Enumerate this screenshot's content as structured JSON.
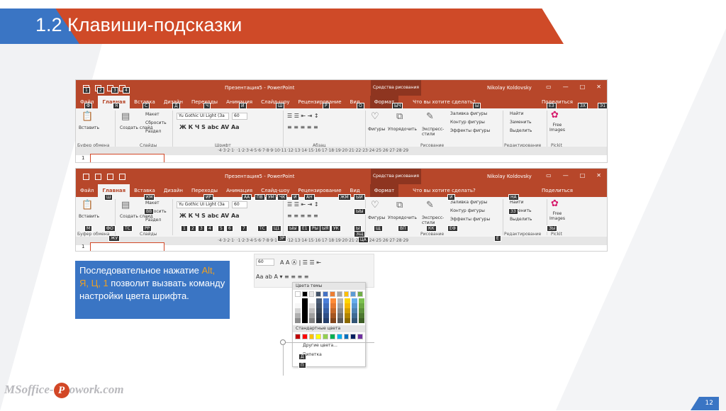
{
  "slide": {
    "title": "1.2 Клавиши-подсказки",
    "page_number": "12",
    "logo_text_1": "MSoffice-",
    "logo_p": "P",
    "logo_text_2": "owork.com"
  },
  "colors": {
    "accent_red": "#cf4a28",
    "accent_blue": "#3a75c4",
    "ppt_ribbon": "#b7472a"
  },
  "app": {
    "title": "Презентация5 - PowerPoint",
    "context": "Средства рисования",
    "user": "Nikolay Koldovsky",
    "tabs": [
      "Файл",
      "Главная",
      "Вставка",
      "Дизайн",
      "Переходы",
      "Анимация",
      "Слайд-шоу",
      "Рецензирование",
      "Вид"
    ],
    "context_tab": "Формат",
    "tell_me": "Что вы хотите сделать?",
    "share": "Поделиться"
  },
  "ribbon": {
    "paste": "Вставить",
    "clipboard": "Буфер обмена",
    "new_slide": "Создать слайд",
    "layout": "Макет",
    "reset": "Сбросить",
    "section": "Раздел",
    "slides": "Слайды",
    "font_name": "Yu Gothic UI Light (За",
    "font_size": "60",
    "font": "Шрифт",
    "paragraph": "Абзац",
    "shapes": "Фигуры",
    "arrange": "Упорядочить",
    "quick_styles": "Экспресс-стили",
    "fill": "Заливка фигуры",
    "outline": "Контур фигуры",
    "effects": "Эффекты фигуры",
    "drawing": "Рисование",
    "find": "Найти",
    "replace": "Заменить",
    "select": "Выделить",
    "editing": "Редактирование",
    "free_images": "Free Images",
    "pickit": "Pickit",
    "ruler_text": "·4·3·2·1· ·1·2·3·4·5·6·7·8·9·10·11·12·13·14·15·16·17·18·19·20·21·22·23·24·25·26·27·28·29",
    "thumb_num": "1"
  },
  "keytips_top": [
    "1",
    "2",
    "3",
    "4",
    "Ф",
    "Я",
    "С",
    "Д",
    "Ч",
    "И",
    "Ш",
    "Р",
    "О",
    "ЫЧ",
    "Ы",
    "ЕЗ",
    "ЗХ",
    "Э1",
    "З1"
  ],
  "keytips_bottom": [
    "Ш",
    "КМ",
    "ВВ",
    "ИР",
    "АА",
    "ПВ",
    "УМ",
    "ЧК",
    "Й",
    "АН",
    "ЖМ",
    "ЫЙ",
    "Й",
    "НА",
    "ЗЗ",
    "ЫЫ",
    "М",
    "ФО",
    "ТС",
    "РР",
    "1",
    "2",
    "3",
    "4",
    "5",
    "6",
    "7",
    "ТС",
    "Ц1",
    "ЫЫ",
    "Е1",
    "РЫ",
    "ЫЯ",
    "УК",
    "Ы",
    "Щ",
    "ВП",
    "КК",
    "ЕФ",
    "ЗЫ",
    "ЖУ",
    "ЗР",
    "ЗЩ",
    "ЦА",
    "Е"
  ],
  "note": {
    "line1": "Последовательное нажатие ",
    "keys": "Alt, Я, Ц, 1",
    "line2": " позволит вызвать команду настройки цвета шрифта."
  },
  "palette": {
    "font_size": "60",
    "theme_colors": "Цвета темы",
    "standard_colors": "Стандартные цвета",
    "more_colors": "Другие цвета...",
    "eyedropper": "Пипетка",
    "keytip_more": "Д",
    "keytip_eye": "П",
    "theme_row": [
      "#ffffff",
      "#000000",
      "#e7e6e6",
      "#44546a",
      "#4472c4",
      "#ed7d31",
      "#a5a5a5",
      "#ffc000",
      "#5b9bd5",
      "#70ad47"
    ],
    "standard_row": [
      "#c00000",
      "#ff0000",
      "#ffc000",
      "#ffff00",
      "#92d050",
      "#00b050",
      "#00b0f0",
      "#0070c0",
      "#002060",
      "#7030a0"
    ]
  }
}
